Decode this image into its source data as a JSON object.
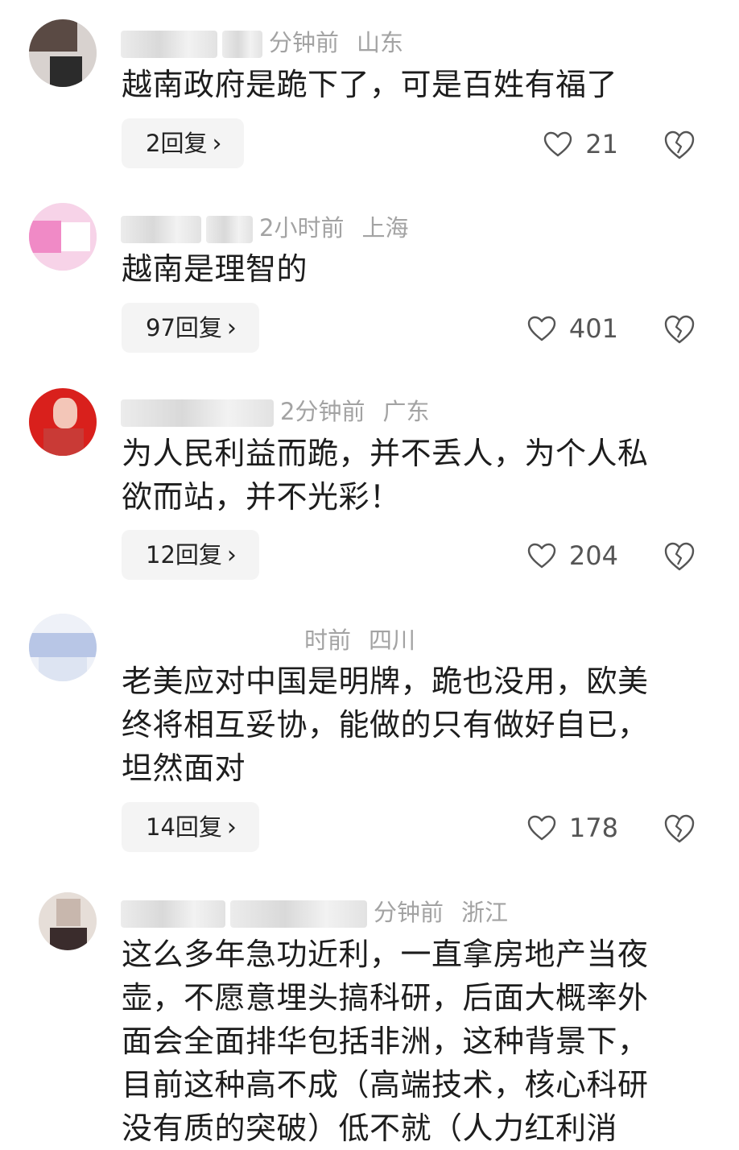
{
  "comments": [
    {
      "time": "分钟前",
      "region": "山东",
      "lines": [
        "越南政府是跪下了，可是百姓有福了"
      ],
      "replies": "2回复",
      "likes": "21",
      "avatar_colors": [
        "#5a4a44",
        "#d8d2cf",
        "#2b2b2b"
      ]
    },
    {
      "time": "2小时前",
      "region": "上海",
      "lines": [
        "越南是理智的"
      ],
      "replies": "97回复",
      "likes": "401",
      "avatar_colors": [
        "#f08ac6",
        "#f7d3e8",
        "#ffffff"
      ]
    },
    {
      "time": "2分钟前",
      "region": "广东",
      "lines": [
        "为人民利益而跪，并不丢人，为个人私",
        "欲而站，并不光彩！"
      ],
      "replies": "12回复",
      "likes": "204",
      "avatar_colors": [
        "#d9201c",
        "#f3c6b8",
        "#c93a36"
      ]
    },
    {
      "time": "时前",
      "region": "四川",
      "lines": [
        "老美应对中国是明牌，跪也没用，欧美",
        "终将相互妥协，能做的只有做好自已，",
        "坦然面对"
      ],
      "replies": "14回复",
      "likes": "178",
      "avatar_colors": [
        "#b8c6e6",
        "#dde4f2",
        "#eef1f8"
      ]
    },
    {
      "time": "分钟前",
      "region": "浙江",
      "lines": [
        "这么多年急功近利，一直拿房地产当夜",
        "壶，不愿意埋头搞科研，后面大概率外",
        "面会全面排华包括非洲，这种背景下，",
        "目前这种高不成（高端技术，核心科研",
        "没有质的突破）低不就（人力红利消"
      ],
      "avatar_colors": [
        "#c8b7ad",
        "#e6ded8",
        "#3a2c2c"
      ]
    }
  ],
  "reply_chevron": "›",
  "icons": {
    "like": "heart-outline-icon",
    "dislike": "broken-heart-icon"
  }
}
